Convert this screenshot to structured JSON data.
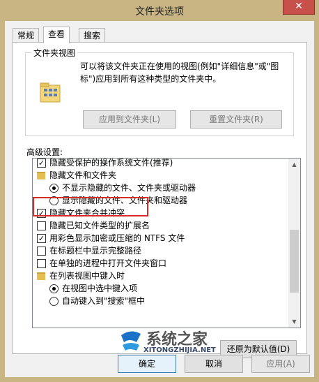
{
  "window": {
    "title": "文件夹选项",
    "close_glyph": "✕"
  },
  "tabs": [
    {
      "label": "常规"
    },
    {
      "label": "查看"
    },
    {
      "label": "搜索"
    }
  ],
  "folder_views": {
    "title": "文件夹视图",
    "description": "可以将该文件夹正在使用的视图(例如\"详细信息\"或\"图标\")应用到所有这种类型的文件夹中。",
    "apply_label": "应用到文件夹(L)",
    "reset_label": "重置文件夹(R)"
  },
  "advanced": {
    "label": "高级设置:",
    "items": [
      {
        "type": "checkbox",
        "checked": true,
        "label": "隐藏受保护的操作系统文件(推荐)"
      },
      {
        "type": "folder",
        "label": "隐藏文件和文件夹"
      },
      {
        "type": "radio",
        "checked": true,
        "label": "不显示隐藏的文件、文件夹或驱动器"
      },
      {
        "type": "radio",
        "checked": false,
        "label": "显示隐藏的文件、文件夹和驱动器"
      },
      {
        "type": "checkbox",
        "checked": true,
        "label": "隐藏文件夹合并冲突"
      },
      {
        "type": "checkbox",
        "checked": false,
        "label": "隐藏已知文件类型的扩展名"
      },
      {
        "type": "checkbox",
        "checked": true,
        "label": "用彩色显示加密或压缩的 NTFS 文件"
      },
      {
        "type": "checkbox",
        "checked": false,
        "label": "在标题栏中显示完整路径"
      },
      {
        "type": "checkbox",
        "checked": false,
        "label": "在单独的进程中打开文件夹窗口"
      },
      {
        "type": "folder",
        "label": "在列表视图中键入时"
      },
      {
        "type": "radio",
        "checked": true,
        "label": "在视图中选中键入项"
      },
      {
        "type": "radio",
        "checked": false,
        "label": "自动键入到\"搜索\"框中"
      }
    ],
    "restore_label": "还原为默认值(D)"
  },
  "footer": {
    "ok_label": "确定",
    "cancel_label": "取消",
    "apply_label": "应用(A)"
  },
  "watermark": {
    "text": "系统之家",
    "url": "XITONGZHIJIA.NET"
  },
  "colors": {
    "highlight": "#d62b27",
    "title_bg": "#c9b484"
  }
}
